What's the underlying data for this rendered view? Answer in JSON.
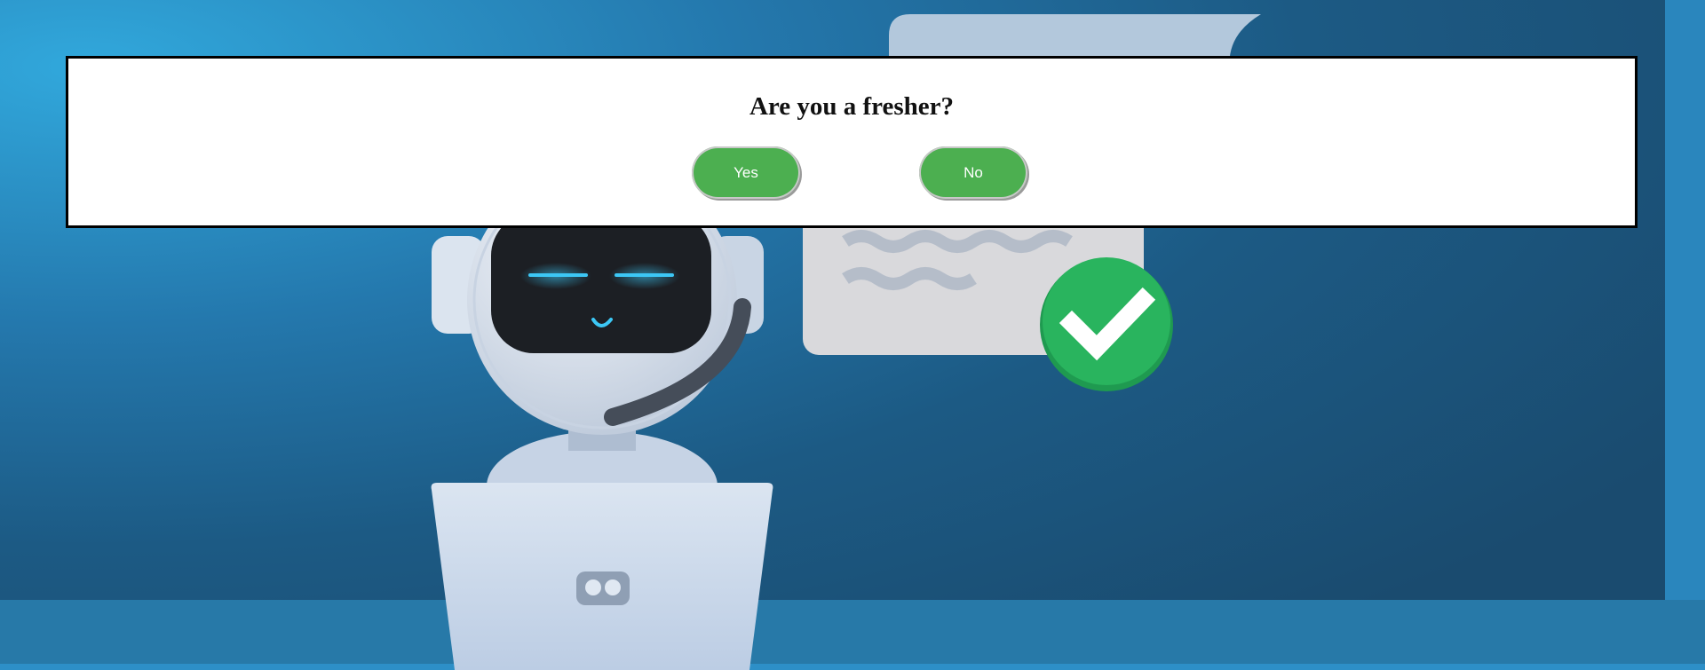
{
  "colors": {
    "background_light": "#2fa6da",
    "background_dark": "#1a4f74",
    "floor": "#2779a8",
    "button_green": "#4caf50",
    "check_green": "#27b35d",
    "robot_visor": "#1c1f24",
    "robot_glow": "#3cc7f5"
  },
  "dialog": {
    "question": "Are you a fresher?",
    "yes_label": "Yes",
    "no_label": "No"
  },
  "illustration": {
    "subject": "robot-at-laptop",
    "check_icon": "check-circle-icon",
    "document_icon": "document-icon"
  }
}
